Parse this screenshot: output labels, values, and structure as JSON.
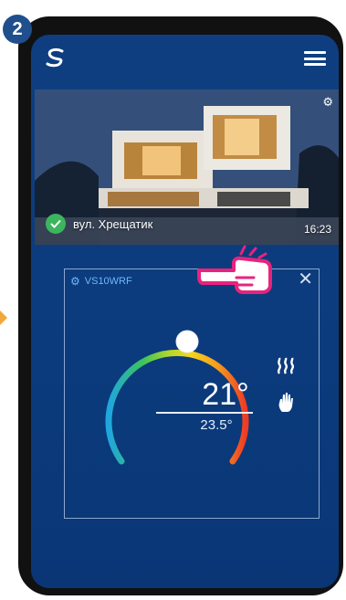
{
  "step": {
    "number": "2"
  },
  "colors": {
    "screen_bg": "#0b3b7c",
    "check": "#3cb55e",
    "accent": "#6fb8ff",
    "pointer": "#e8237d"
  },
  "topbar": {
    "logo_icon": "salus-logo-icon",
    "menu_icon": "hamburger-menu-icon"
  },
  "home": {
    "name": "вул. Хрещатик",
    "time": "16:23",
    "settings_icon": "gear-icon",
    "status_icon": "check-icon"
  },
  "device": {
    "name": "VS10WRF",
    "current_temp": "21°",
    "set_temp": "23.5°",
    "mode_icons": [
      "heating-icon",
      "manual-hand-icon"
    ],
    "close_icon": "close-icon"
  }
}
